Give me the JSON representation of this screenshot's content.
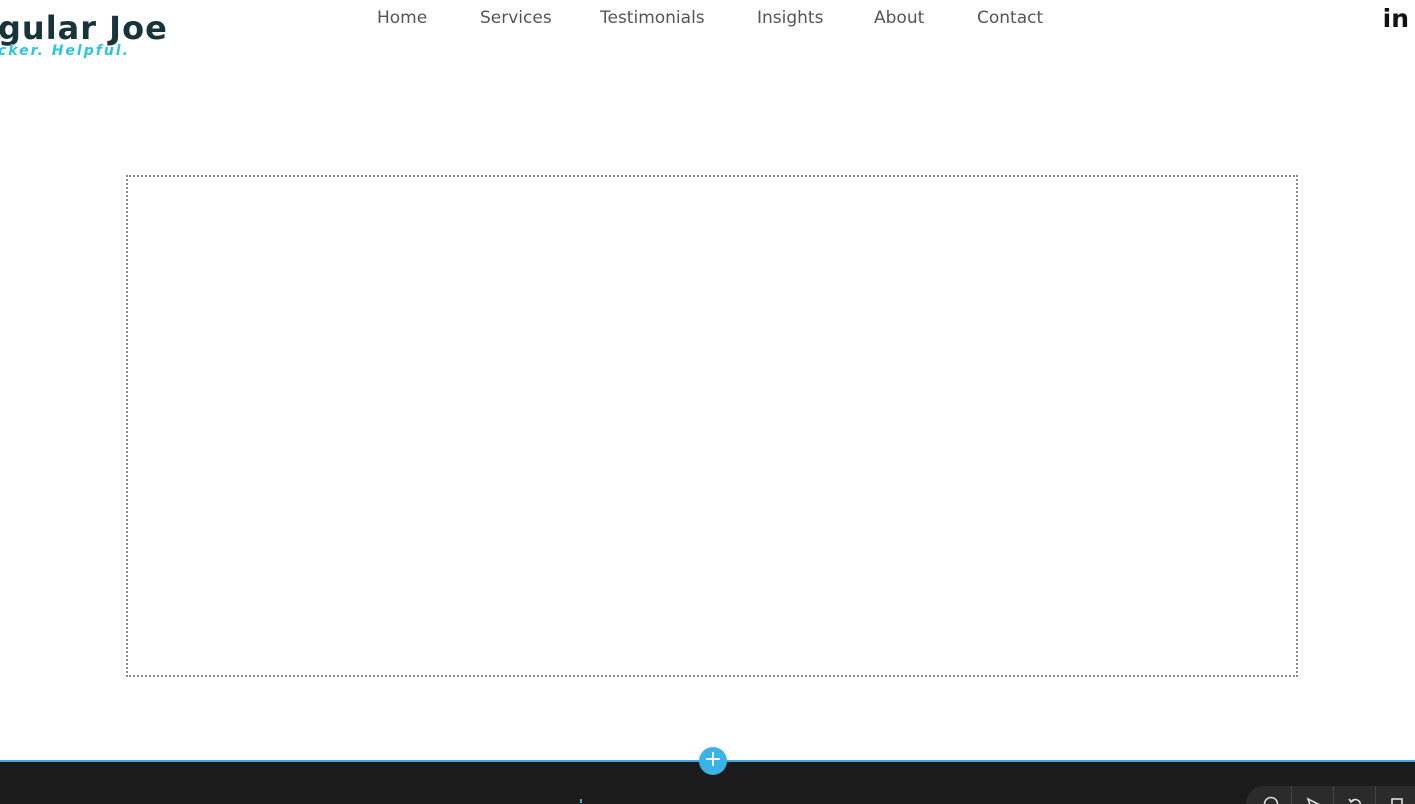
{
  "header": {
    "logo": {
      "title": "gular Joe",
      "tagline": "cker. Helpful."
    },
    "nav": [
      {
        "label": "Home"
      },
      {
        "label": "Services"
      },
      {
        "label": "Testimonials"
      },
      {
        "label": "Insights"
      },
      {
        "label": "About"
      },
      {
        "label": "Contact"
      }
    ],
    "social": {
      "linkedin_label": "in"
    }
  },
  "footer": {
    "add_section_label": "+"
  },
  "toolbar": {
    "tools": [
      {
        "icon": "help-icon"
      },
      {
        "icon": "pointer-icon"
      },
      {
        "icon": "undo-icon"
      },
      {
        "icon": "panel-icon"
      }
    ]
  },
  "colors": {
    "brand_dark": "#16343a",
    "brand_accent": "#2cc6dc",
    "nav_text": "#555555",
    "footer_bg": "#1b1b1b",
    "editor_blue": "#3ab3e6"
  }
}
